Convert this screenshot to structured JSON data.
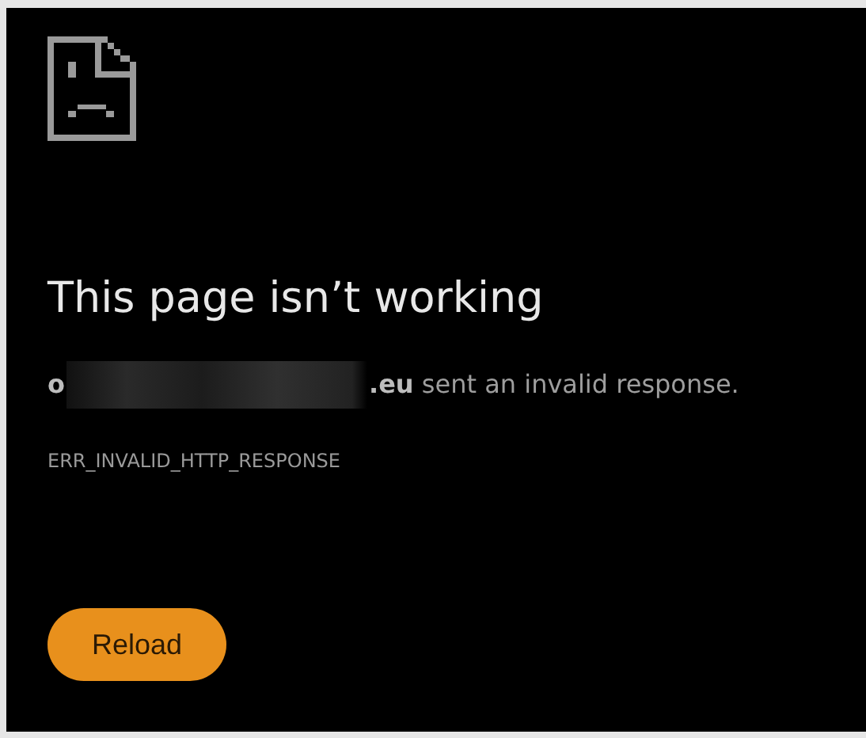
{
  "error_page": {
    "title": "This page isn’t working",
    "message": {
      "host_start": "o",
      "host_redacted": true,
      "rest": "**.eu** sent an invalid response."
    },
    "error_code": "ERR_INVALID_HTTP_RESPONSE",
    "buttons": [
      {
        "label": "Reload",
        "kind": "primary"
      }
    ]
  }
}
